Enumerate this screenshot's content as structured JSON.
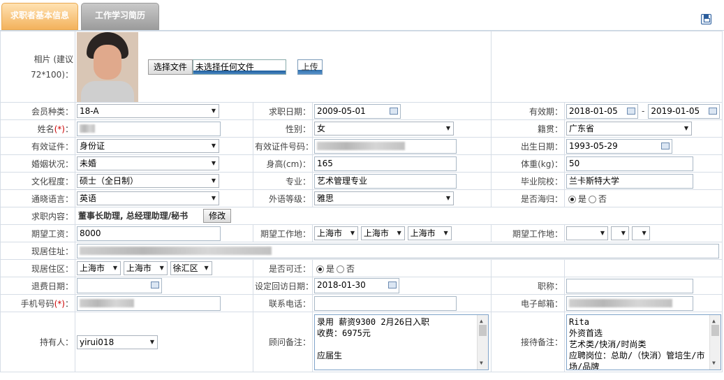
{
  "tabs": [
    {
      "label": "求职者基本信息"
    },
    {
      "label": "工作学习简历"
    }
  ],
  "save_icon": "save-icon",
  "photo": {
    "label": "相片 (建议72*100)：",
    "choose_button": "选择文件",
    "no_file": "未选择任何文件",
    "upload_button": "上传"
  },
  "row1": {
    "member_type_label": "会员种类：",
    "member_type": "18-A",
    "apply_date_label": "求职日期：",
    "apply_date": "2009-05-01",
    "valid_label": "有效期：",
    "valid_from": "2018-01-05",
    "dash": "-",
    "valid_to": "2019-01-05"
  },
  "row2": {
    "name_label": "姓名",
    "req": "(*)",
    "colon": "：",
    "gender_label": "性别：",
    "gender": "女",
    "origin_label": "籍贯：",
    "origin": "广东省"
  },
  "row3": {
    "id_type_label": "有效证件：",
    "id_type": "身份证",
    "id_no_label": "有效证件号码：",
    "birth_label": "出生日期：",
    "birth": "1993-05-29"
  },
  "row4": {
    "marital_label": "婚姻状况：",
    "marital": "未婚",
    "height_label": "身高(cm)：",
    "height": "165",
    "weight_label": "体重(kg)：",
    "weight": "50"
  },
  "row5": {
    "edu_label": "文化程度：",
    "edu": "硕士（全日制）",
    "major_label": "专业：",
    "major": "艺术管理专业",
    "school_label": "毕业院校：",
    "school": "兰卡斯特大学"
  },
  "row6": {
    "lang_label": "通晓语言：",
    "lang": "英语",
    "lang_level_label": "外语等级：",
    "lang_level": "雅思",
    "returnee_label": "是否海归：",
    "yes": "是",
    "no": "否"
  },
  "row7": {
    "job_label": "求职内容：",
    "job": "董事长助理, 总经理助理/秘书",
    "edit_button": "修改"
  },
  "row8": {
    "salary_label": "期望工资：",
    "salary": "8000",
    "place_label": "期望工作地：",
    "place1": "上海市",
    "place2": "上海市",
    "place3": "上海市",
    "place2_label": "期望工作地："
  },
  "row9": {
    "address_label": "现居住址："
  },
  "row10": {
    "district_label": "现居住区：",
    "d1": "上海市",
    "d2": "上海市",
    "d3": "徐汇区",
    "relocate_label": "是否可迁：",
    "yes": "是",
    "no": "否"
  },
  "row11": {
    "refund_label": "退费日期：",
    "revisit_label": "设定回访日期：",
    "revisit": "2018-01-30",
    "title_label": "职称："
  },
  "row12": {
    "mobile_label": "手机号码",
    "req": "(*)",
    "colon": "：",
    "phone_label": "联系电话：",
    "email_label": "电子邮箱："
  },
  "row13": {
    "owner_label": "持有人：",
    "owner": "yirui018",
    "consultant_label": "顾问备注：",
    "consultant_note": "录用 薪资9300 2月26日入职\n收费：6975元\n\n应届生",
    "reception_label": "接待备注：",
    "reception_note": "Rita\n外资首选\n艺术类/快消/时尚类\n应聘岗位：总助/（快消）管培生/市场/品牌"
  }
}
